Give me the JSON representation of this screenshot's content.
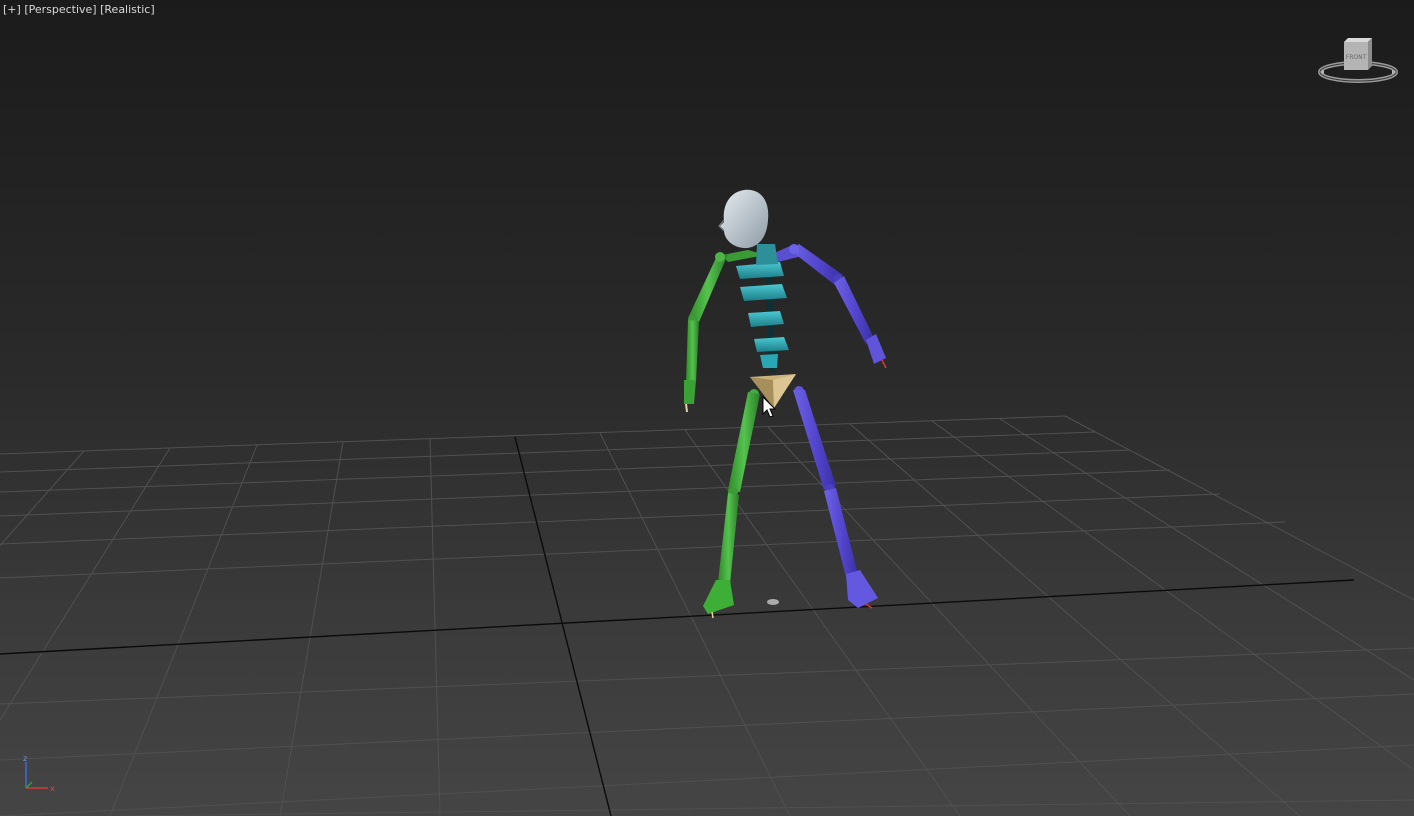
{
  "viewport": {
    "menu_label": "[+]",
    "view_label": "[Perspective]",
    "shading_label": "[Realistic]"
  },
  "viewcube": {
    "face_label": "FRONT"
  },
  "axis_gizmo": {
    "z_label": "z",
    "x_label": "x"
  },
  "colors": {
    "background_top": "#1b1b1b",
    "background_bottom": "#454545",
    "grid_line": "#4d4d4d",
    "grid_axis": "#0a0a0a",
    "left_limb": "#3fa83a",
    "right_limb": "#5a4fd0",
    "spine": "#2aa7b3",
    "pelvis": "#cbb27a",
    "head": "#c9d3dc"
  },
  "icons": [
    "viewcube-icon",
    "axis-gizmo-icon",
    "mouse-cursor-icon"
  ]
}
